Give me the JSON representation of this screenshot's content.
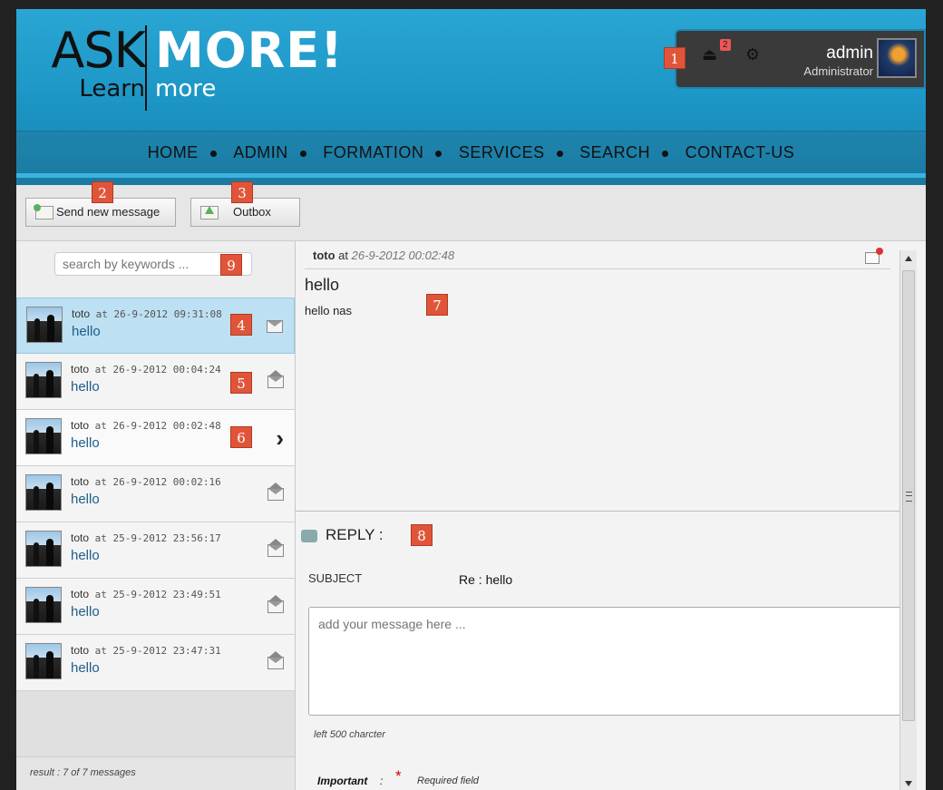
{
  "logo": {
    "ask": "ASK",
    "learn": "Learn",
    "more": "MORE!",
    "more_sub": "more"
  },
  "user": {
    "name": "admin",
    "role": "Administrator",
    "notifications": "2"
  },
  "nav": {
    "items": [
      "HOME",
      "ADMIN",
      "FORMATION",
      "SERVICES",
      "SEARCH",
      "CONTACT-US"
    ]
  },
  "toolbar": {
    "send_label": "Send new message",
    "outbox_label": "Outbox"
  },
  "search": {
    "placeholder": "search by keywords ..."
  },
  "messages": [
    {
      "sender": "toto",
      "at": "at",
      "date": "26-9-2012 09:31:08",
      "subject": "hello",
      "status": "unread"
    },
    {
      "sender": "toto",
      "at": "at",
      "date": "26-9-2012 00:04:24",
      "subject": "hello",
      "status": "read"
    },
    {
      "sender": "toto",
      "at": "at",
      "date": "26-9-2012 00:02:48",
      "subject": "hello",
      "status": "current"
    },
    {
      "sender": "toto",
      "at": "at",
      "date": "26-9-2012 00:02:16",
      "subject": "hello",
      "status": "read"
    },
    {
      "sender": "toto",
      "at": "at",
      "date": "25-9-2012 23:56:17",
      "subject": "hello",
      "status": "read"
    },
    {
      "sender": "toto",
      "at": "at",
      "date": "25-9-2012 23:49:51",
      "subject": "hello",
      "status": "read"
    },
    {
      "sender": "toto",
      "at": "at",
      "date": "25-9-2012 23:47:31",
      "subject": "hello",
      "status": "read"
    }
  ],
  "list_footer": "result : 7 of 7 messages",
  "detail": {
    "sender": "toto",
    "at": "at",
    "date": "26-9-2012 00:02:48",
    "title": "hello",
    "body": "hello nas"
  },
  "reply": {
    "label": "REPLY :",
    "subject_label": "SUBJECT",
    "subject_value": "Re : hello",
    "placeholder": "add your message here ...",
    "left_chars": "left 500 charcter",
    "important_label": "Important",
    "important_colon": ":",
    "required_star": "*",
    "required_text": "Required field"
  },
  "badges": [
    "1",
    "2",
    "3",
    "4",
    "5",
    "6",
    "7",
    "8",
    "9"
  ],
  "colors": {
    "header": "#1d97c6",
    "badge": "#e0553a",
    "selected_row": "#bde0f2"
  }
}
